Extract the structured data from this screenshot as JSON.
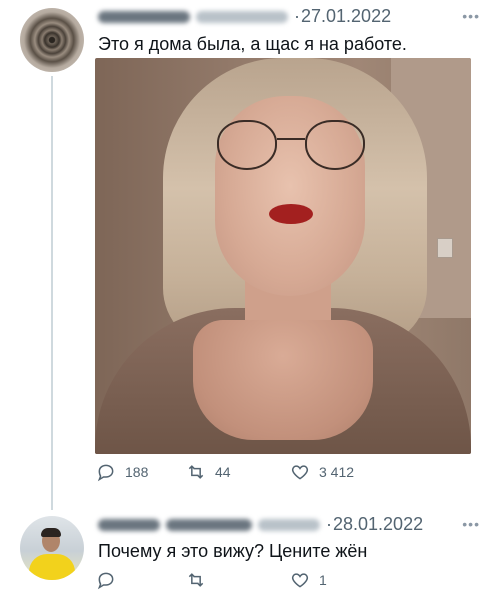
{
  "tweets": [
    {
      "date": "27.01.2022",
      "text": "Это я дома была, а щас я на работе.",
      "more": "•••",
      "stats": {
        "replies": "188",
        "retweets": "44",
        "likes": "3 412"
      }
    },
    {
      "date": "28.01.2022",
      "text": "Почему я это вижу? Цените жён",
      "more": "•••",
      "stats": {
        "replies": "",
        "retweets": "",
        "likes": "1"
      }
    }
  ],
  "separator": "·",
  "colors": {
    "secondary_text": "#536471",
    "thread_line": "#cfd9de",
    "primary_text": "#0f1419"
  }
}
